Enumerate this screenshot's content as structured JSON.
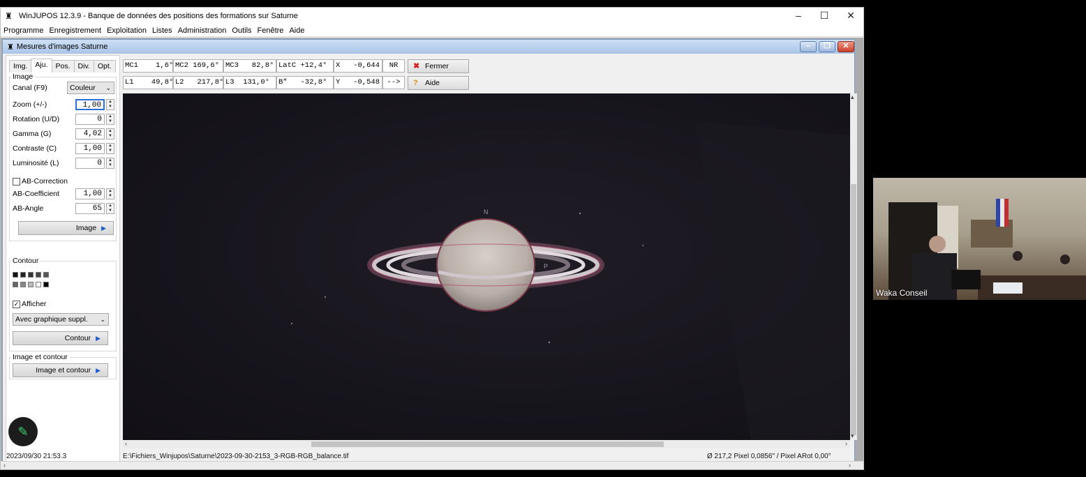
{
  "window": {
    "title": "WinJUPOS 12.3.9 - Banque de données des positions des formations sur Saturne",
    "app_icon": "jupos-icon",
    "controls": [
      "–",
      "☐",
      "✕"
    ]
  },
  "menu": [
    "Programme",
    "Enregistrement",
    "Exploitation",
    "Listes",
    "Administration",
    "Outils",
    "Fenêtre",
    "Aide"
  ],
  "child": {
    "title": "Mesures d'images Saturne"
  },
  "tabs": [
    "Img.",
    "Aju.",
    "Pos.",
    "Div.",
    "Opt."
  ],
  "active_tab": "Aju.",
  "image_group": {
    "title": "Image",
    "canal_label": "Canal (F9)",
    "canal_value": "Couleur",
    "zoom_label": "Zoom (+/-)",
    "zoom_value": "1,00",
    "rotation_label": "Rotation (U/D)",
    "rotation_value": "0",
    "gamma_label": "Gamma (G)",
    "gamma_value": "4,02",
    "contrast_label": "Contraste (C)",
    "contrast_value": "1,00",
    "lum_label": "Luminosité (L)",
    "lum_value": "0",
    "ab_correction_label": "AB-Correction",
    "ab_coef_label": "AB-Coefficient",
    "ab_coef_value": "1,00",
    "ab_angle_label": "AB-Angle",
    "ab_angle_value": "65",
    "button": "Image"
  },
  "contour_group": {
    "title": "Contour",
    "show_label": "Afficher",
    "mode_value": "Avec graphique suppl.",
    "button": "Contour",
    "swatches_row1": [
      "#111111",
      "#222222",
      "#333333",
      "#444444",
      "#555555"
    ],
    "swatches_row2": [
      "#666666",
      "#888888",
      "#bbbbbb",
      "#ffffff",
      "#000000"
    ]
  },
  "image_contour_group": {
    "title": "Image et contour",
    "button": "Image et contour"
  },
  "readout": {
    "mc1": "MC1    1,6°",
    "mc2": "MC2 169,6°",
    "mc3": "MC3   82,8°",
    "latc": "LatC +12,4°",
    "x": "X   -0,644",
    "nr": "NR",
    "l1": "L1    49,8°",
    "l2": "L2   217,8°",
    "l3": "L3  131,0°",
    "b": "B\"   -32,8°",
    "y": "Y   -0,548",
    "arrow": "-->"
  },
  "actions": {
    "close": "Fermer",
    "help": "Aide"
  },
  "viewport": {
    "north_label": "N",
    "p_label": "P"
  },
  "status": {
    "datetime": "2023/09/30   21:53.3",
    "file": "E:\\Fichiers_Winjupos\\Saturne\\2023-09-30-2153_3-RGB-RGB_balance.tif",
    "scale": "Ø 217,2 Pixel    0,0856\" / Pixel    ARot 0,00°"
  },
  "video": {
    "participant": "Waka Conseil"
  }
}
